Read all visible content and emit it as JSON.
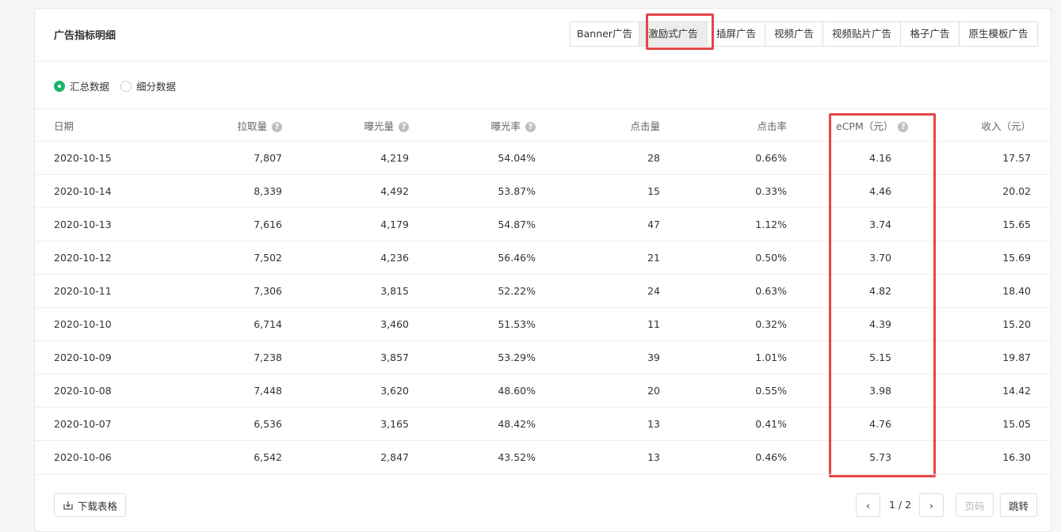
{
  "title": "广告指标明细",
  "tabs": [
    "Banner广告",
    "激励式广告",
    "插屏广告",
    "视频广告",
    "视频贴片广告",
    "格子广告",
    "原生模板广告"
  ],
  "active_tab": "激励式广告",
  "radios": [
    {
      "label": "汇总数据",
      "checked": true
    },
    {
      "label": "细分数据",
      "checked": false
    }
  ],
  "columns": [
    "日期",
    "拉取量",
    "曝光量",
    "曝光率",
    "点击量",
    "点击率",
    "eCPM（元）",
    "收入（元）"
  ],
  "rows": [
    [
      "2020-10-15",
      "7,807",
      "4,219",
      "54.04%",
      "28",
      "0.66%",
      "4.16",
      "17.57"
    ],
    [
      "2020-10-14",
      "8,339",
      "4,492",
      "53.87%",
      "15",
      "0.33%",
      "4.46",
      "20.02"
    ],
    [
      "2020-10-13",
      "7,616",
      "4,179",
      "54.87%",
      "47",
      "1.12%",
      "3.74",
      "15.65"
    ],
    [
      "2020-10-12",
      "7,502",
      "4,236",
      "56.46%",
      "21",
      "0.50%",
      "3.70",
      "15.69"
    ],
    [
      "2020-10-11",
      "7,306",
      "3,815",
      "52.22%",
      "24",
      "0.63%",
      "4.82",
      "18.40"
    ],
    [
      "2020-10-10",
      "6,714",
      "3,460",
      "51.53%",
      "11",
      "0.32%",
      "4.39",
      "15.20"
    ],
    [
      "2020-10-09",
      "7,238",
      "3,857",
      "53.29%",
      "39",
      "1.01%",
      "5.15",
      "19.87"
    ],
    [
      "2020-10-08",
      "7,448",
      "3,620",
      "48.60%",
      "20",
      "0.55%",
      "3.98",
      "14.42"
    ],
    [
      "2020-10-07",
      "6,536",
      "3,165",
      "48.42%",
      "13",
      "0.41%",
      "4.76",
      "15.05"
    ],
    [
      "2020-10-06",
      "6,542",
      "2,847",
      "43.52%",
      "13",
      "0.46%",
      "5.73",
      "16.30"
    ]
  ],
  "footer": {
    "download_label": "下载表格",
    "page_indicator": "1 / 2",
    "page_input_placeholder": "页码",
    "jump_label": "跳转"
  },
  "colors": {
    "accent": "#1cb46b",
    "highlight": "#e54747"
  }
}
